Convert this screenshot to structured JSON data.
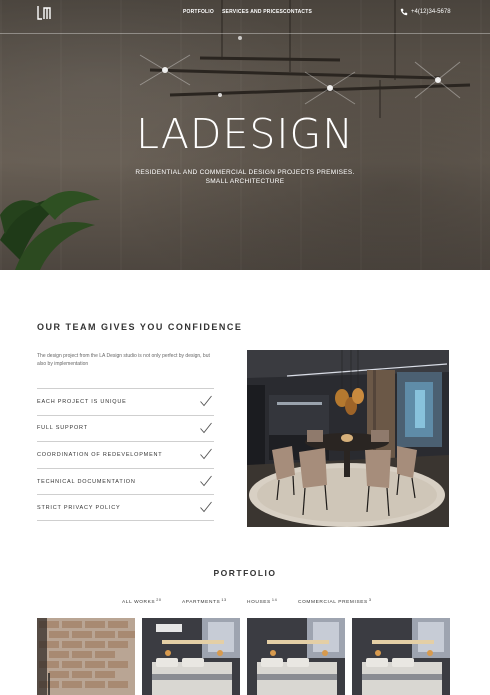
{
  "header": {
    "logo_text": "LA",
    "nav": [
      {
        "label": "PORTFOLIO"
      },
      {
        "label": "SERVICES AND PRICES"
      },
      {
        "label": "CONTACTS"
      }
    ],
    "phone": "+4(12)34-5678"
  },
  "hero": {
    "title": "LADESIGN",
    "subtitle_line1": "RESIDENTIAL AND COMMERCIAL DESIGN PROJECTS PREMISES.",
    "subtitle_line2": "SMALL ARCHITECTURE"
  },
  "team": {
    "title": "OUR TEAM GIVES YOU CONFIDENCE",
    "description": "The design project from the LA Design studio is not only perfect by design, but also by implementation",
    "features": [
      {
        "label": "EACH PROJECT IS UNIQUE"
      },
      {
        "label": "FULL SUPPORT"
      },
      {
        "label": "COORDINATION OF REDEVELOPMENT"
      },
      {
        "label": "TECHNICAL DOCUMENTATION"
      },
      {
        "label": "STRICT PRIVACY POLICY"
      }
    ]
  },
  "portfolio": {
    "title": "PORTFOLIO",
    "filters": [
      {
        "label": "ALL WORKS",
        "count": "20"
      },
      {
        "label": "APARTMENTS",
        "count": "13"
      },
      {
        "label": "HOUSES",
        "count": "14"
      },
      {
        "label": "COMMERCIAL PREMISES",
        "count": "3"
      }
    ]
  },
  "colors": {
    "hero_overlay": "#5a5249",
    "text": "#333333",
    "divider": "#cfcfcf"
  }
}
